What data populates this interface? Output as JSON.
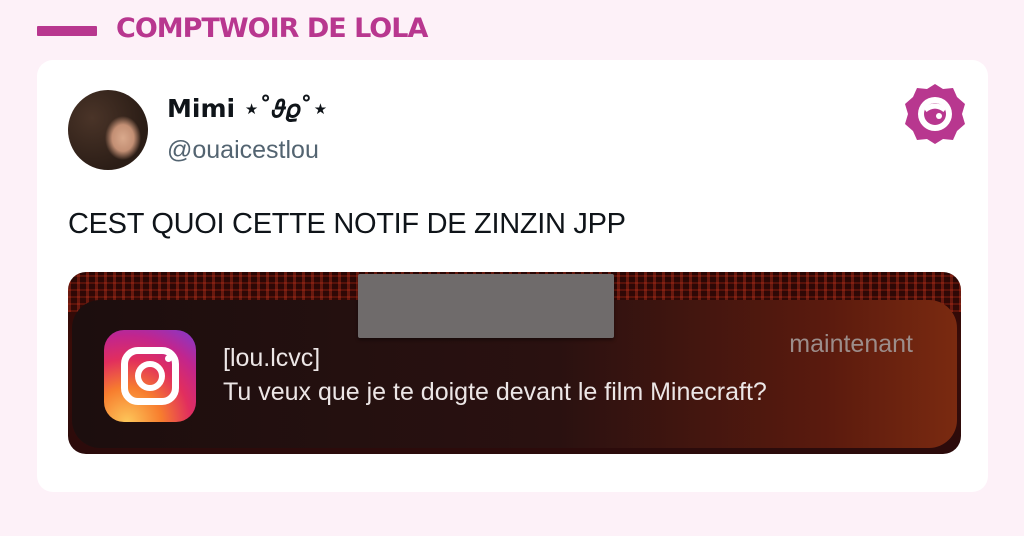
{
  "header": {
    "brand": "COMPTWOIR DE LOLA"
  },
  "tweet": {
    "display_name": "Mimi ⋆˚𝜗𝜚˚⋆",
    "handle": "@ouaicestlou",
    "text": "CEST QUOI CETTE NOTIF DE ZINZIN JPP"
  },
  "notification": {
    "app_icon": "instagram-icon",
    "sender": "[lou.lcvc]",
    "time": "maintenant",
    "body": "Tu veux que je te doigte devant le film Minecraft?"
  },
  "colors": {
    "brand": "#b8378f",
    "background": "#fdf1f8"
  }
}
